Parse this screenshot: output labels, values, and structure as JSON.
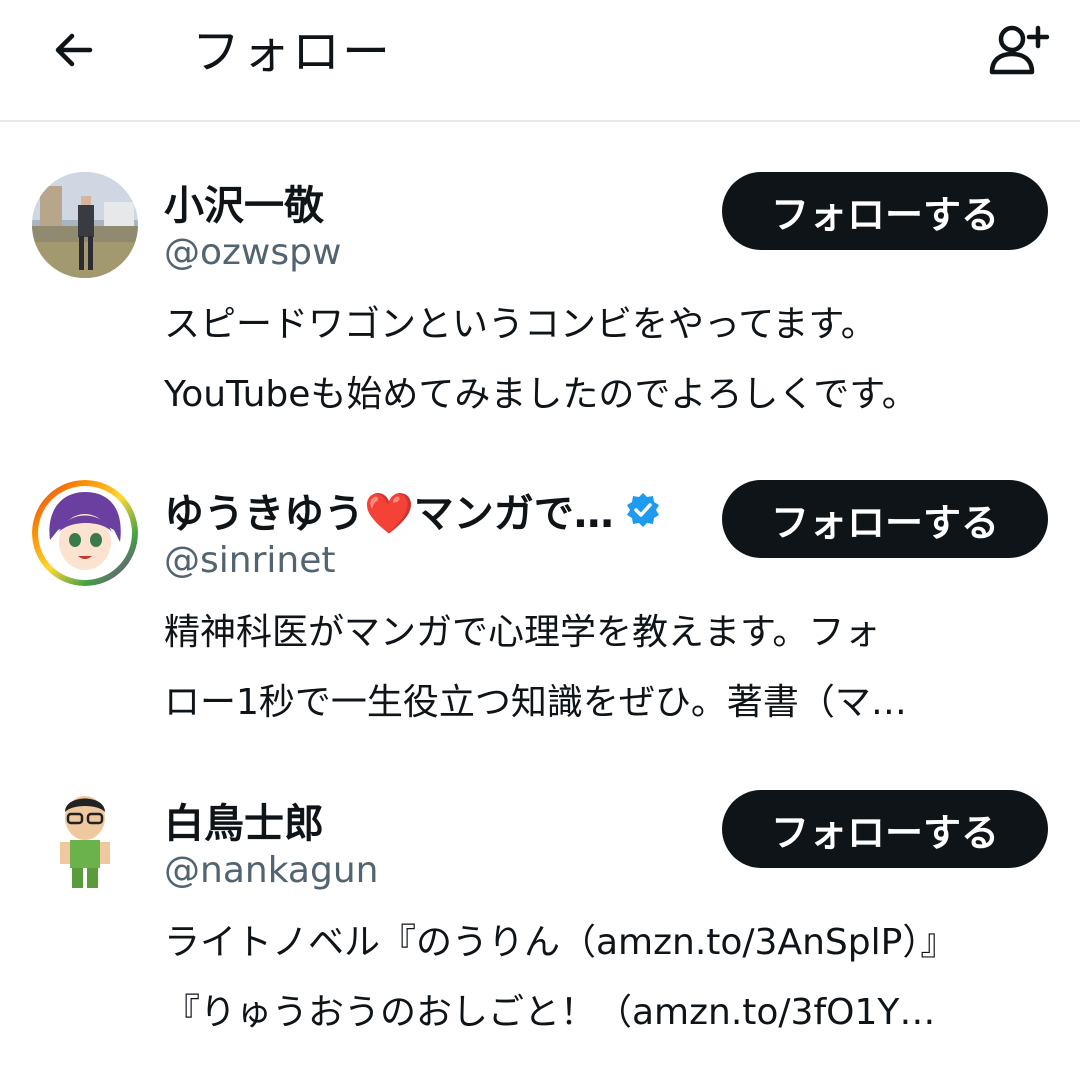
{
  "header": {
    "title": "フォロー",
    "back_icon": "arrow-left-icon",
    "add_user_icon": "person-plus-icon"
  },
  "users": [
    {
      "name": "小沢一敬",
      "handle": "@ozwspw",
      "verified": false,
      "follow_label": "フォローする",
      "bio": [
        "スピードワゴンというコンビをやってます。",
        "YouTubeも始めてみましたのでよろしくです。"
      ]
    },
    {
      "name": "ゆうきゆう❤️マンガで…",
      "handle": "@sinrinet",
      "verified": true,
      "follow_label": "フォローする",
      "bio": [
        "精神科医がマンガで心理学を教えます。フォ",
        "ロー1秒で一生役立つ知識をぜひ。著書（マ…"
      ]
    },
    {
      "name": "白鳥士郎",
      "handle": "@nankagun",
      "verified": false,
      "follow_label": "フォローする",
      "bio": [
        "ライトノベル『のうりん（amzn.to/3AnSplP）』",
        "『りゅうおうのおしごと！（amzn.to/3fO1Y…"
      ]
    }
  ],
  "colors": {
    "text": "#0f1419",
    "secondary": "#536471",
    "button_bg": "#0f1419",
    "verified": "#1d9bf0",
    "divider": "#e6e9eb"
  }
}
